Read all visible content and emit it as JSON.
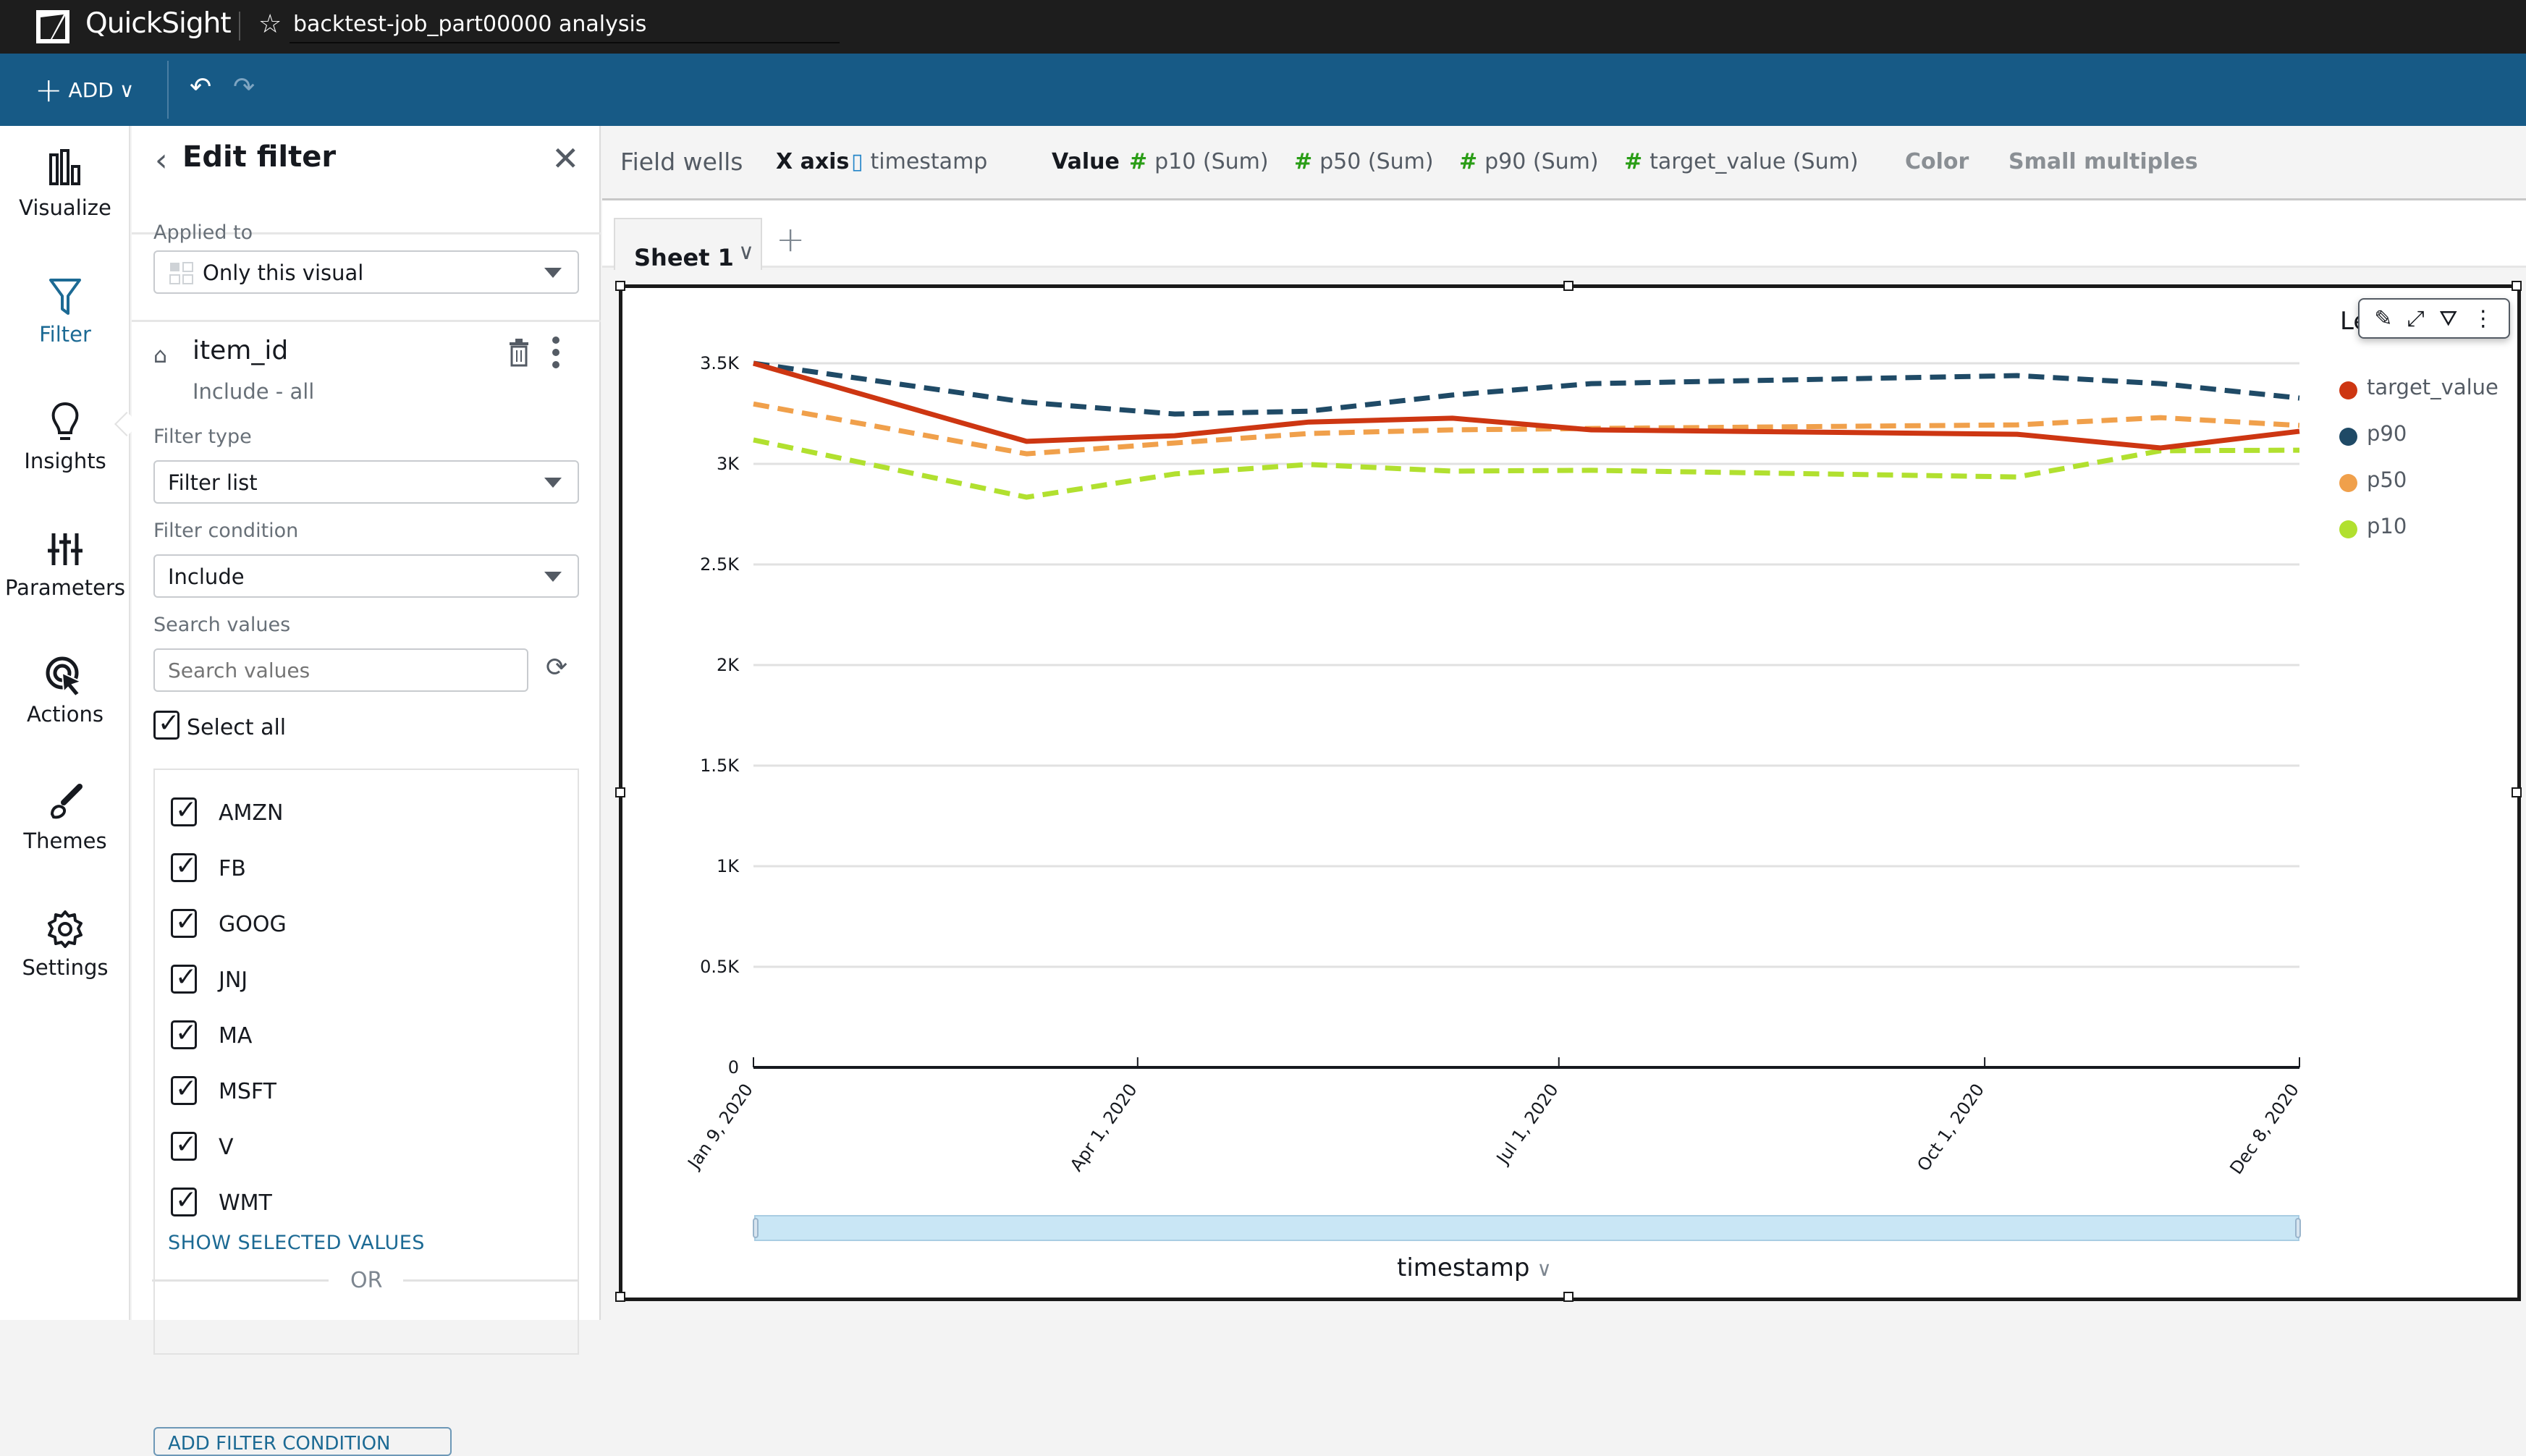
{
  "titlebar": {
    "app_name": "QuickSight",
    "analysis_title": "backtest-job_part00000 analysis",
    "star_icon": "☆"
  },
  "toolbar": {
    "add_label": "ADD",
    "add_caret": "∨",
    "undo_icon": "↶",
    "redo_icon": "↷"
  },
  "leftnav": {
    "items": [
      {
        "label": "Visualize",
        "icon": "bar-chart-icon"
      },
      {
        "label": "Filter",
        "icon": "filter-icon",
        "active": true
      },
      {
        "label": "Insights",
        "icon": "lightbulb-icon"
      },
      {
        "label": "Parameters",
        "icon": "sliders-icon"
      },
      {
        "label": "Actions",
        "icon": "cursor-click-icon"
      },
      {
        "label": "Themes",
        "icon": "paintbrush-icon"
      },
      {
        "label": "Settings",
        "icon": "gear-icon"
      }
    ]
  },
  "filter_panel": {
    "back_icon": "‹",
    "title": "Edit filter",
    "close_icon": "✕",
    "applied_to_label": "Applied to",
    "applied_to_value": "Only this visual",
    "field_name": "item_id",
    "field_summary": "Include - all",
    "filter_type_label": "Filter type",
    "filter_type_value": "Filter list",
    "filter_condition_label": "Filter condition",
    "filter_condition_value": "Include",
    "search_label": "Search values",
    "search_placeholder": "Search values",
    "refresh_icon": "⟳",
    "select_all_label": "Select all",
    "select_all_checked": true,
    "values": [
      {
        "label": "AMZN",
        "checked": true
      },
      {
        "label": "FB",
        "checked": true
      },
      {
        "label": "GOOG",
        "checked": true
      },
      {
        "label": "JNJ",
        "checked": true
      },
      {
        "label": "MA",
        "checked": true
      },
      {
        "label": "MSFT",
        "checked": true
      },
      {
        "label": "V",
        "checked": true
      },
      {
        "label": "WMT",
        "checked": true
      }
    ],
    "show_selected_label": "SHOW SELECTED VALUES",
    "or_label": "OR",
    "add_condition_label": "ADD FILTER CONDITION"
  },
  "field_wells": {
    "title": "Field wells",
    "x_axis_label": "X axis",
    "x_axis_field": "timestamp",
    "value_label": "Value",
    "value_fields": [
      "p10 (Sum)",
      "p50 (Sum)",
      "p90 (Sum)",
      "target_value (Sum)"
    ],
    "color_label": "Color",
    "small_multiples_label": "Small multiples"
  },
  "sheets": {
    "tabs": [
      {
        "label": "Sheet 1",
        "active": true
      }
    ],
    "add_icon": "+"
  },
  "visual_toolbar": {
    "icons": [
      "edit-icon",
      "expand-icon",
      "filter-icon",
      "more-icon"
    ]
  },
  "chart_data": {
    "type": "line",
    "title": "",
    "xlabel": "timestamp",
    "ylabel": "",
    "ylim": [
      0,
      3500
    ],
    "yticks": [
      0,
      500,
      1000,
      1500,
      2000,
      2500,
      3000,
      3500
    ],
    "ytick_labels": [
      "0",
      "0.5K",
      "1K",
      "1.5K",
      "2K",
      "2.5K",
      "3K",
      "3.5K"
    ],
    "xlim": [
      "2020-01-09",
      "2020-12-08"
    ],
    "xticks": [
      "2020-01-09",
      "2020-04-01",
      "2020-07-01",
      "2020-10-01",
      "2020-12-08"
    ],
    "xtick_labels": [
      "Jan 9, 2020",
      "Apr 1, 2020",
      "Jul 1, 2020",
      "Oct 1, 2020",
      "Dec 8, 2020"
    ],
    "grid": true,
    "legend_title": "Legend",
    "legend_position": "right",
    "x": [
      "2020-01-09",
      "2020-03-08",
      "2020-04-09",
      "2020-05-08",
      "2020-06-08",
      "2020-07-08",
      "2020-10-08",
      "2020-11-08",
      "2020-12-08"
    ],
    "series": [
      {
        "name": "target_value",
        "color": "#cd3612",
        "dash": false,
        "values": [
          3500,
          3112,
          3140,
          3208,
          3227,
          3169,
          3147,
          3079,
          3162
        ]
      },
      {
        "name": "p90",
        "color": "#1f4a66",
        "dash": true,
        "values": [
          3500,
          3306,
          3248,
          3262,
          3342,
          3399,
          3439,
          3399,
          3327
        ]
      },
      {
        "name": "p50",
        "color": "#f0a04b",
        "dash": true,
        "values": [
          3298,
          3050,
          3104,
          3151,
          3169,
          3176,
          3194,
          3230,
          3191
        ]
      },
      {
        "name": "p10",
        "color": "#b1e02f",
        "dash": true,
        "values": [
          3119,
          2834,
          2950,
          2997,
          2964,
          2968,
          2935,
          3065,
          3068
        ]
      }
    ]
  }
}
